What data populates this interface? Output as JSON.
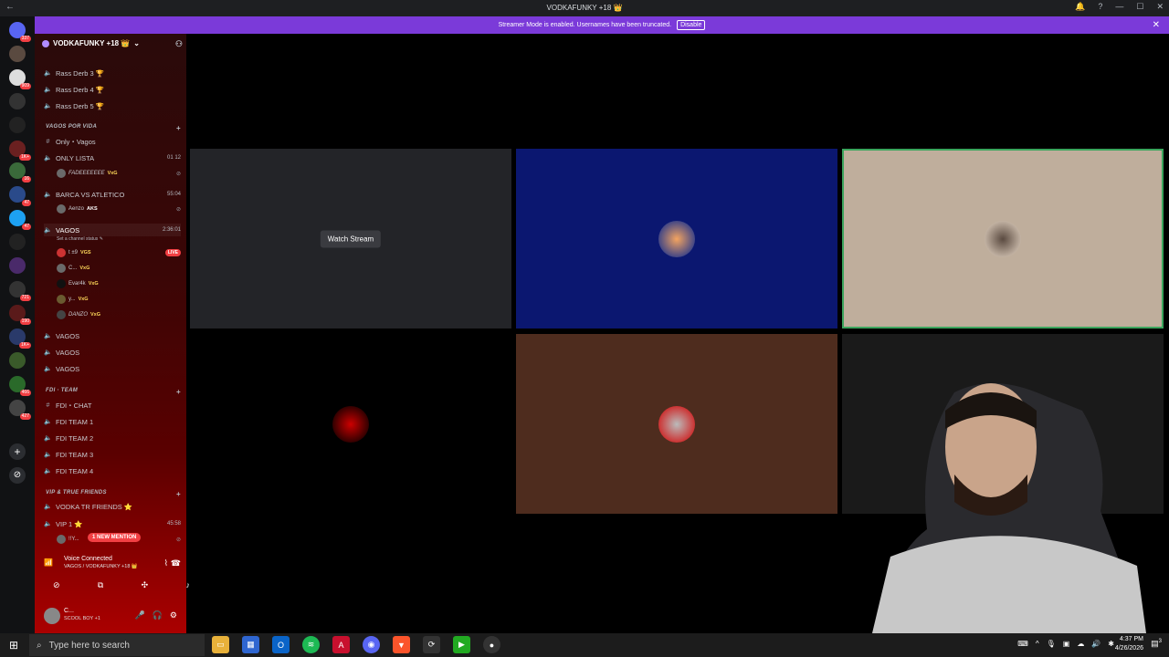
{
  "window": {
    "title": "VODKAFUNKY +18 👑",
    "controls": [
      "🔔",
      "?",
      "—",
      "☐",
      "✕"
    ]
  },
  "banner": {
    "text": "Streamer Mode is enabled. Usernames have been truncated.",
    "disable_label": "Disable"
  },
  "servers": [
    {
      "badge": "337"
    },
    {
      "badge": ""
    },
    {
      "badge": "909"
    },
    {
      "badge": ""
    },
    {
      "badge": ""
    },
    {
      "badge": "1K+"
    },
    {
      "badge": "16"
    },
    {
      "badge": "47"
    },
    {
      "badge": "47"
    },
    {
      "badge": ""
    },
    {
      "badge": "721"
    },
    {
      "badge": "190"
    },
    {
      "badge": "1K+"
    },
    {
      "badge": ""
    },
    {
      "badge": "466"
    },
    {
      "badge": "427"
    }
  ],
  "guild": {
    "name": "VODKAFUNKY +18 👑"
  },
  "channels": {
    "rass3": "Rass Derb 3 🏆",
    "rass4": "Rass Derb 4 🏆",
    "rass5": "Rass Derb 5 🏆",
    "cat_vagos": "VAGOS POR VIDA",
    "only_vagos": "Only・Vagos",
    "only_lista": "ONLY LISTA",
    "only_lista_count": "01  12",
    "barca": "BARCA VS ATLETICO",
    "barca_time": "55:04",
    "vagos_main": "VAGOS",
    "vagos_main_time": "2:36:01",
    "vagos_status": "Set a channel status ✎",
    "vagos2": "VAGOS",
    "vagos3": "VAGOS",
    "vagos4": "VAGOS",
    "cat_fdi": "FDI · TEAM",
    "fdi_chat": "FDI・CHAT",
    "fdi1": "FDI TEAM 1",
    "fdi2": "FDI TEAM 2",
    "fdi3": "FDI TEAM 3",
    "fdi4": "FDI TEAM 4",
    "cat_vip": "VIP & TRUE FRIENDS",
    "vodka_tr": "VODKA TR FRIENDS ⭐",
    "vip1": "VIP 1 ⭐",
    "vip1_time": "45:58"
  },
  "users": {
    "u_fade": "FADEEEEEEE",
    "u_fade_tag": "VxG",
    "u_aenzo": "Aenzo",
    "u_aenzo_tag": "AKS",
    "u_1": "t ±9",
    "u_1_tag": "VGS",
    "u_2": "C...",
    "u_2_tag": "VxG",
    "u_3": "Evar4k",
    "u_3_tag": "VxG",
    "u_4": "y...",
    "u_4_tag": "VxG",
    "u_5": "DANZO",
    "u_5_tag": "VxG",
    "live": "LIVE",
    "u_vip": "!!Y..."
  },
  "mention": "1 NEW MENTION",
  "voice": {
    "status": "Voice Connected",
    "location": "VAGOS / VODKAFUNKY +18 👑"
  },
  "userbar": {
    "name": "C...",
    "status": "SCOOL BOY +1"
  },
  "stage": {
    "watch_label": "Watch Stream"
  },
  "taskbar": {
    "search_placeholder": "Type here to search",
    "time": "4:37 PM",
    "date": "4/26/2026",
    "notif_count": "3"
  }
}
